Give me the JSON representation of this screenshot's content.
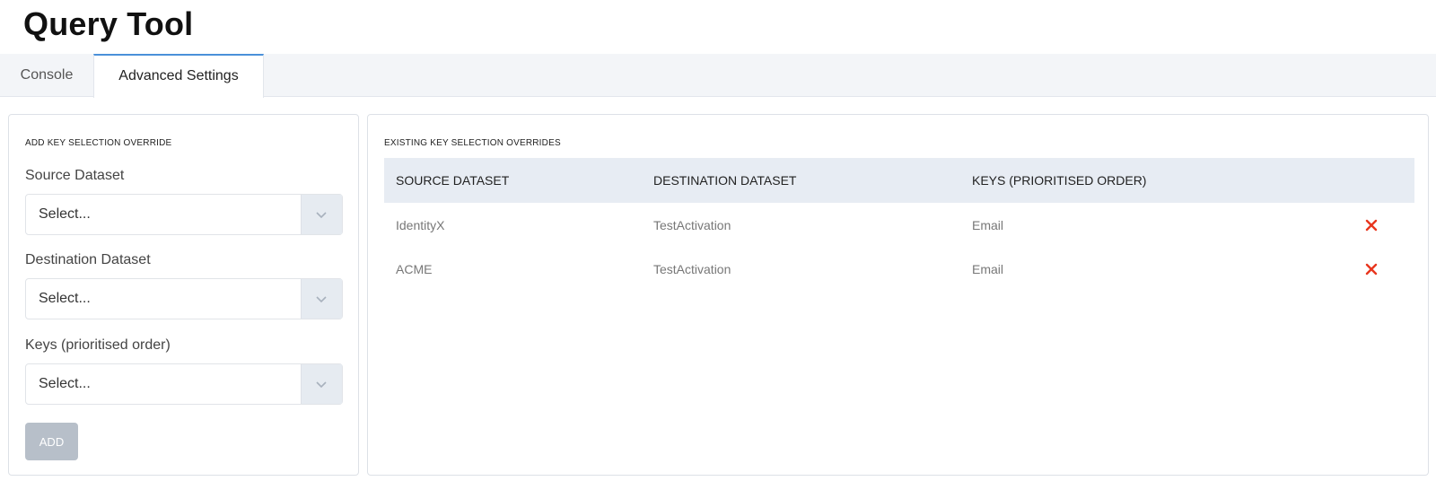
{
  "page": {
    "title": "Query Tool"
  },
  "tabs": [
    {
      "label": "Console",
      "active": false
    },
    {
      "label": "Advanced Settings",
      "active": true
    }
  ],
  "add_panel": {
    "heading": "ADD KEY SELECTION OVERRIDE",
    "fields": [
      {
        "label": "Source Dataset",
        "placeholder": "Select..."
      },
      {
        "label": "Destination Dataset",
        "placeholder": "Select..."
      },
      {
        "label": "Keys (prioritised order)",
        "placeholder": "Select..."
      }
    ],
    "add_button": "ADD"
  },
  "existing_panel": {
    "heading": "EXISTING KEY SELECTION OVERRIDES",
    "columns": [
      "SOURCE DATASET",
      "DESTINATION DATASET",
      "KEYS (PRIORITISED ORDER)"
    ],
    "rows": [
      {
        "source": "IdentityX",
        "destination": "TestActivation",
        "keys": "Email"
      },
      {
        "source": "ACME",
        "destination": "TestActivation",
        "keys": "Email"
      }
    ]
  },
  "colors": {
    "accent": "#4a90d9",
    "delete": "#e8361e",
    "header_bg": "#e7ecf3",
    "button_disabled": "#b7bfc9"
  },
  "icons": {
    "dropdown": "chevron-down-icon",
    "delete": "close-icon"
  }
}
